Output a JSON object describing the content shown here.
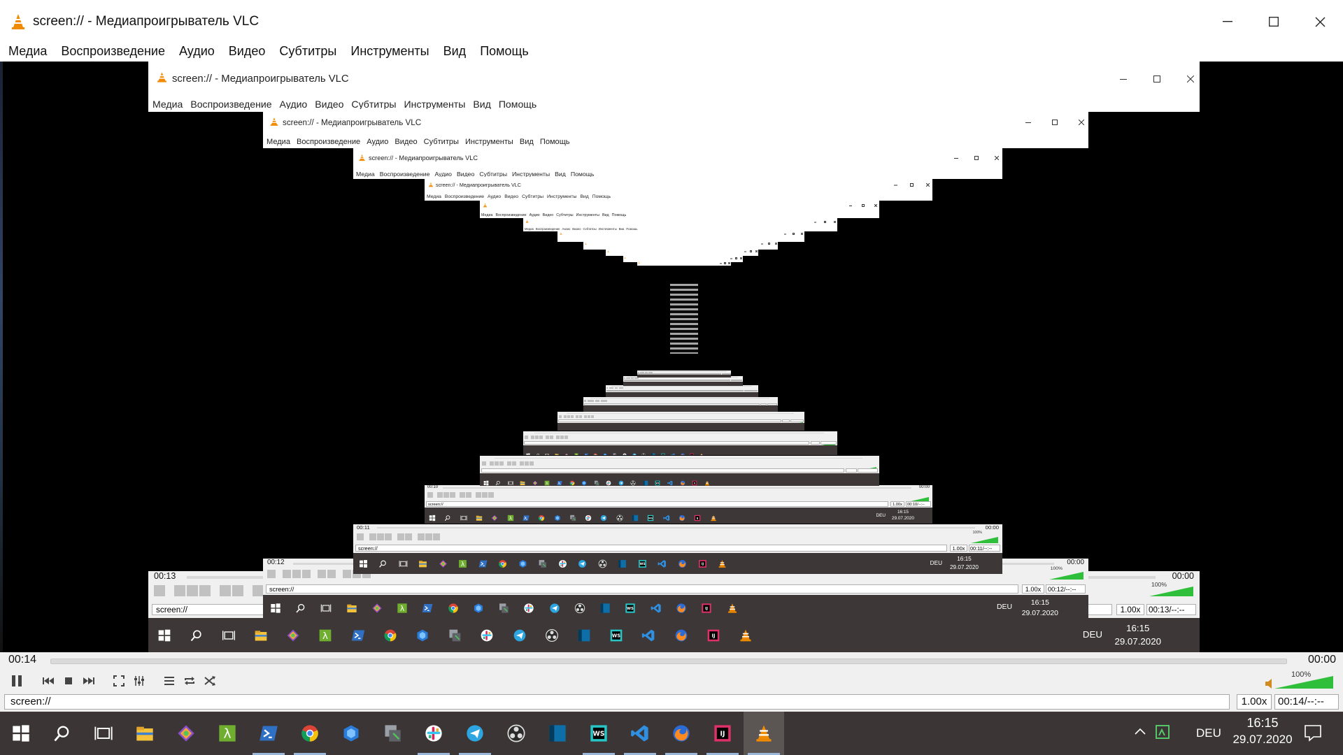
{
  "window": {
    "title": "screen:// - Медиапроигрыватель VLC",
    "controls": [
      "minimize",
      "maximize",
      "close"
    ]
  },
  "menu": [
    "Медиа",
    "Воспроизведение",
    "Аудио",
    "Видео",
    "Субтитры",
    "Инструменты",
    "Вид",
    "Помощь"
  ],
  "player": {
    "elapsed": "00:14",
    "remaining": "00:00",
    "status_text": "screen://",
    "speed": "1.00x",
    "position": "00:14/--:--",
    "volume": "100%",
    "buttons": [
      "pause-icon",
      "prev-icon",
      "stop-icon",
      "next-icon",
      "fullscreen-icon",
      "extended-settings-icon",
      "playlist-icon",
      "loop-icon",
      "shuffle-icon"
    ]
  },
  "nested": [
    {
      "elapsed": "00:13",
      "remaining": "00:00",
      "status_text": "screen://",
      "speed": "1.00x",
      "position": "00:13/--:--",
      "volume": "100%",
      "time": "16:15",
      "date": "29.07.2020",
      "lang": "DEU"
    },
    {
      "elapsed": "00:12",
      "remaining": "00:00",
      "status_text": "screen://",
      "speed": "1.00x",
      "position": "00:12/--:--",
      "volume": "100%",
      "time": "16:15",
      "date": "29.07.2020",
      "lang": "DEU"
    },
    {
      "elapsed": "00:11",
      "remaining": "00:00",
      "status_text": "screen://",
      "speed": "1.00x",
      "position": "00:11/--:--",
      "volume": "100%",
      "time": "16:15",
      "date": "29.07.2020",
      "lang": "DEU"
    },
    {
      "elapsed": "00:10",
      "remaining": "00:00",
      "status_text": "screen://",
      "speed": "1.00x",
      "position": "00:10/--:--",
      "volume": "",
      "time": "16:15",
      "date": "29.07.2020",
      "lang": "DEU"
    },
    {
      "elapsed": "",
      "remaining": "",
      "status_text": "",
      "speed": "",
      "position": "",
      "volume": "",
      "time": "",
      "date": "",
      "lang": ""
    },
    {
      "elapsed": "",
      "remaining": "",
      "status_text": "",
      "speed": "",
      "position": "",
      "volume": "",
      "time": "",
      "date": "",
      "lang": ""
    },
    {
      "elapsed": "",
      "remaining": "",
      "status_text": "",
      "speed": "",
      "position": "",
      "volume": "",
      "time": "",
      "date": "",
      "lang": ""
    },
    {
      "elapsed": "",
      "remaining": "",
      "status_text": "",
      "speed": "",
      "position": "",
      "volume": "",
      "time": "",
      "date": "",
      "lang": ""
    },
    {
      "elapsed": "",
      "remaining": "",
      "status_text": "",
      "speed": "",
      "position": "",
      "volume": "",
      "time": "",
      "date": "",
      "lang": ""
    },
    {
      "elapsed": "",
      "remaining": "",
      "status_text": "",
      "speed": "",
      "position": "",
      "volume": "",
      "time": "",
      "date": "",
      "lang": ""
    },
    {
      "elapsed": "",
      "remaining": "",
      "status_text": "",
      "speed": "",
      "position": "",
      "volume": "",
      "time": "",
      "date": "",
      "lang": ""
    }
  ],
  "taskbar": {
    "apps": [
      {
        "name": "start-icon"
      },
      {
        "name": "search-icon"
      },
      {
        "name": "task-view-icon"
      },
      {
        "name": "file-explorer-icon"
      },
      {
        "name": "git-kraken-icon"
      },
      {
        "name": "lambda-app-icon"
      },
      {
        "name": "powershell-icon"
      },
      {
        "name": "chrome-icon"
      },
      {
        "name": "3d-viewer-icon"
      },
      {
        "name": "snipping-tool-icon"
      },
      {
        "name": "slack-icon"
      },
      {
        "name": "telegram-icon"
      },
      {
        "name": "obs-icon"
      },
      {
        "name": "terminal-panel-icon"
      },
      {
        "name": "webstorm-icon"
      },
      {
        "name": "vscode-icon"
      },
      {
        "name": "firefox-icon"
      },
      {
        "name": "intellij-icon"
      },
      {
        "name": "vlc-icon"
      }
    ],
    "active_app": "vlc-icon",
    "lang": "DEU",
    "time": "16:15",
    "date": "29.07.2020"
  },
  "colors": {
    "taskbar": "#3b3635",
    "vlc_orange": "#f08a00",
    "volume_green": "#2fbf3a",
    "window_bg": "#f0f0f0"
  }
}
